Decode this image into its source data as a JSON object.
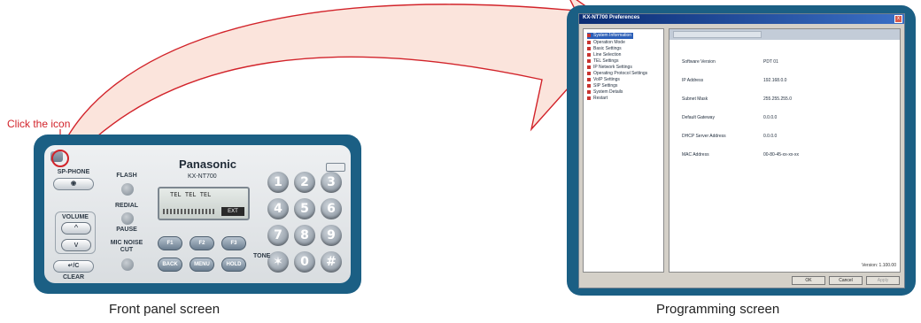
{
  "callout": {
    "text": "Click the icon"
  },
  "captions": {
    "front_panel": "Front panel screen",
    "programming": "Programming  screen"
  },
  "colors": {
    "frame": "#1b5f84",
    "arrow_fill": "#fbe4dc",
    "arrow_stroke": "#d2232a",
    "callout": "#d2232a"
  },
  "front_panel": {
    "brand": "Panasonic",
    "model": "KX-NT700",
    "icon": "settings-icon",
    "sp_phone": "SP-PHONE",
    "flash": "FLASH",
    "redial": "REDIAL",
    "pause": "PAUSE",
    "volume": "VOLUME",
    "volume_up": "^",
    "volume_down": "v",
    "mic_noise_cut": "MIC NOISE CUT",
    "clear_key": "↵/C",
    "clear": "CLEAR",
    "lcd_line": "TEL  TEL  TEL",
    "lcd_tag": "EXT",
    "fkeys": [
      "F1",
      "F2",
      "F3"
    ],
    "softkeys": [
      "BACK",
      "MENU",
      "HOLD"
    ],
    "tone": "TONE",
    "battery": "",
    "keypad": [
      "1",
      "2",
      "3",
      "4",
      "5",
      "6",
      "7",
      "8",
      "9",
      "✶",
      "0",
      "#"
    ]
  },
  "programming": {
    "title": "KX-NT700 Preferences",
    "close": "x",
    "tree": [
      "System Information",
      "Operation Mode",
      "Basic Settings",
      "Line Selection",
      "TEL Settings",
      "IP Network Settings",
      "Operating Protocol Settings",
      "VoIP Settings",
      "SIP Settings",
      "System Details",
      "Restart"
    ],
    "rows": [
      {
        "label": "Software Version",
        "value": "PDT 01"
      },
      {
        "label": "IP Address",
        "value": "192.168.0.0"
      },
      {
        "label": "Subnet Mask",
        "value": "255.255.255.0"
      },
      {
        "label": "Default Gateway",
        "value": "0.0.0.0"
      },
      {
        "label": "DHCP Server Address",
        "value": "0.0.0.0"
      },
      {
        "label": "MAC Address",
        "value": "00-80-45-xx-xx-xx"
      }
    ],
    "version": "Version: 1.100.00",
    "buttons": [
      "OK",
      "Cancel",
      "Apply"
    ]
  }
}
